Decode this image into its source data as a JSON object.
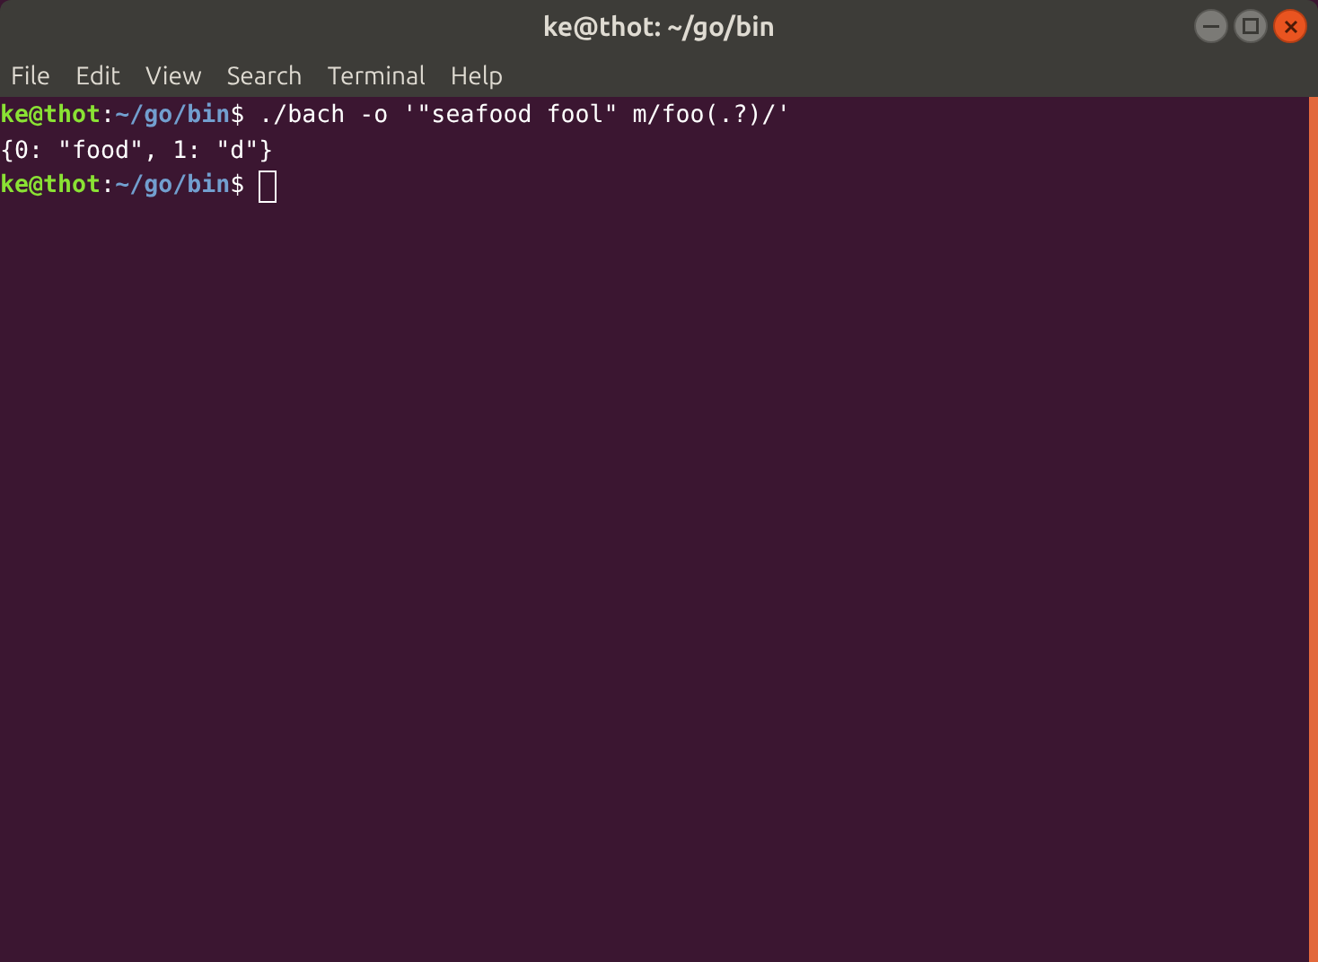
{
  "window": {
    "title": "ke@thot: ~/go/bin"
  },
  "menu": [
    "File",
    "Edit",
    "View",
    "Search",
    "Terminal",
    "Help"
  ],
  "terminal": {
    "lines": [
      {
        "segments": [
          {
            "kind": "user",
            "text": "ke@thot"
          },
          {
            "kind": "plain",
            "text": ":"
          },
          {
            "kind": "path",
            "text": "~/go/bin"
          },
          {
            "kind": "plain",
            "text": "$ ./bach -o '\"seafood fool\" m/foo(.?)/'"
          }
        ],
        "cursor": false
      },
      {
        "segments": [
          {
            "kind": "plain",
            "text": "{0: \"food\", 1: \"d\"}"
          }
        ],
        "cursor": false
      },
      {
        "segments": [
          {
            "kind": "user",
            "text": "ke@thot"
          },
          {
            "kind": "plain",
            "text": ":"
          },
          {
            "kind": "path",
            "text": "~/go/bin"
          },
          {
            "kind": "plain",
            "text": "$ "
          }
        ],
        "cursor": true
      }
    ]
  }
}
